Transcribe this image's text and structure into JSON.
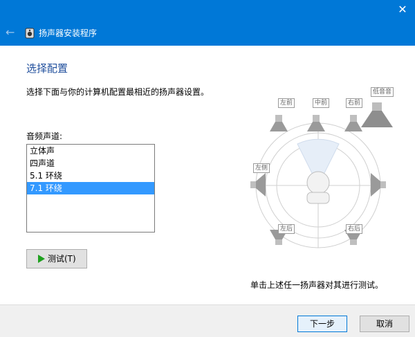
{
  "window": {
    "app_title": "扬声器安装程序",
    "close_icon": "close-icon",
    "back_icon": "back-arrow-icon"
  },
  "page": {
    "heading": "选择配置",
    "description": "选择下面与你的计算机配置最相近的扬声器设置。",
    "channels_label": "音频声道:",
    "channels": [
      "立体声",
      "四声道",
      "5.1 环绕",
      "7.1 环绕"
    ],
    "selected_channel": "7.1 环绕",
    "test_button": "测试(T)",
    "hint": "单击上述任一扬声器对其进行测试。"
  },
  "speakers": {
    "front_left": "左前",
    "center": "中前",
    "front_right": "右前",
    "subwoofer": "低音音",
    "side_left": "左侧",
    "rear_left": "左后",
    "rear_right": "右后"
  },
  "footer": {
    "next": "下一步",
    "cancel": "取消"
  },
  "colors": {
    "titlebar": "#0078d7",
    "selection": "#3399ff",
    "heading": "#1f4e9c"
  }
}
